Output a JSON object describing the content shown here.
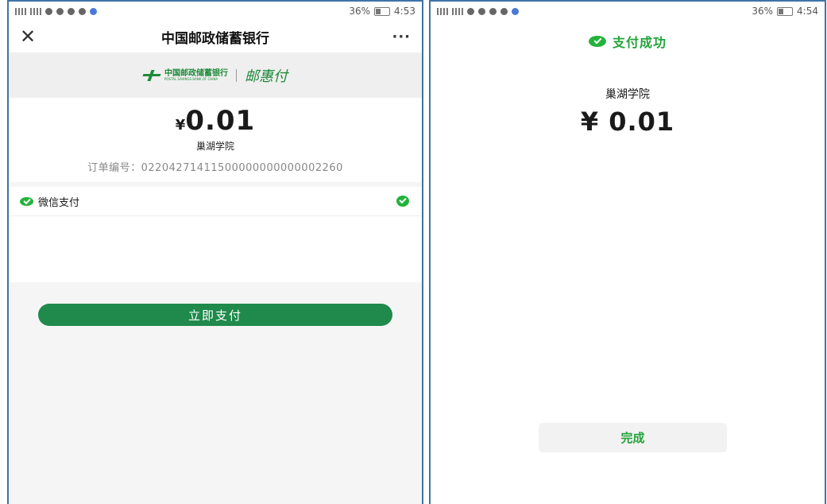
{
  "left": {
    "status_bar": {
      "battery": "36%",
      "time": "4:53"
    },
    "nav": {
      "close_glyph": "✕",
      "title": "中国邮政储蓄银行",
      "more_glyph": "···"
    },
    "banner": {
      "bank_name_cn": "中国邮政储蓄银行",
      "bank_name_en": "POSTAL SAVINGS BANK OF CHINA",
      "service_name": "邮惠付"
    },
    "payment": {
      "currency_symbol": "¥",
      "amount": "0.01",
      "merchant": "巢湖学院",
      "order_label": "订单编号：",
      "order_number": "02204271411500000000000002260"
    },
    "method": {
      "label": "微信支付",
      "icon": "wechat-pay-icon",
      "selected": true
    },
    "pay_button_label": "立即支付"
  },
  "right": {
    "status_bar": {
      "battery": "36%",
      "time": "4:54"
    },
    "success_text": "支付成功",
    "merchant": "巢湖学院",
    "currency_symbol": "¥",
    "amount": "0.01",
    "done_button_label": "完成"
  },
  "colors": {
    "accent_green": "#1f8a4b",
    "wechat_green": "#24b33b",
    "frame_blue": "#3f73a8"
  }
}
